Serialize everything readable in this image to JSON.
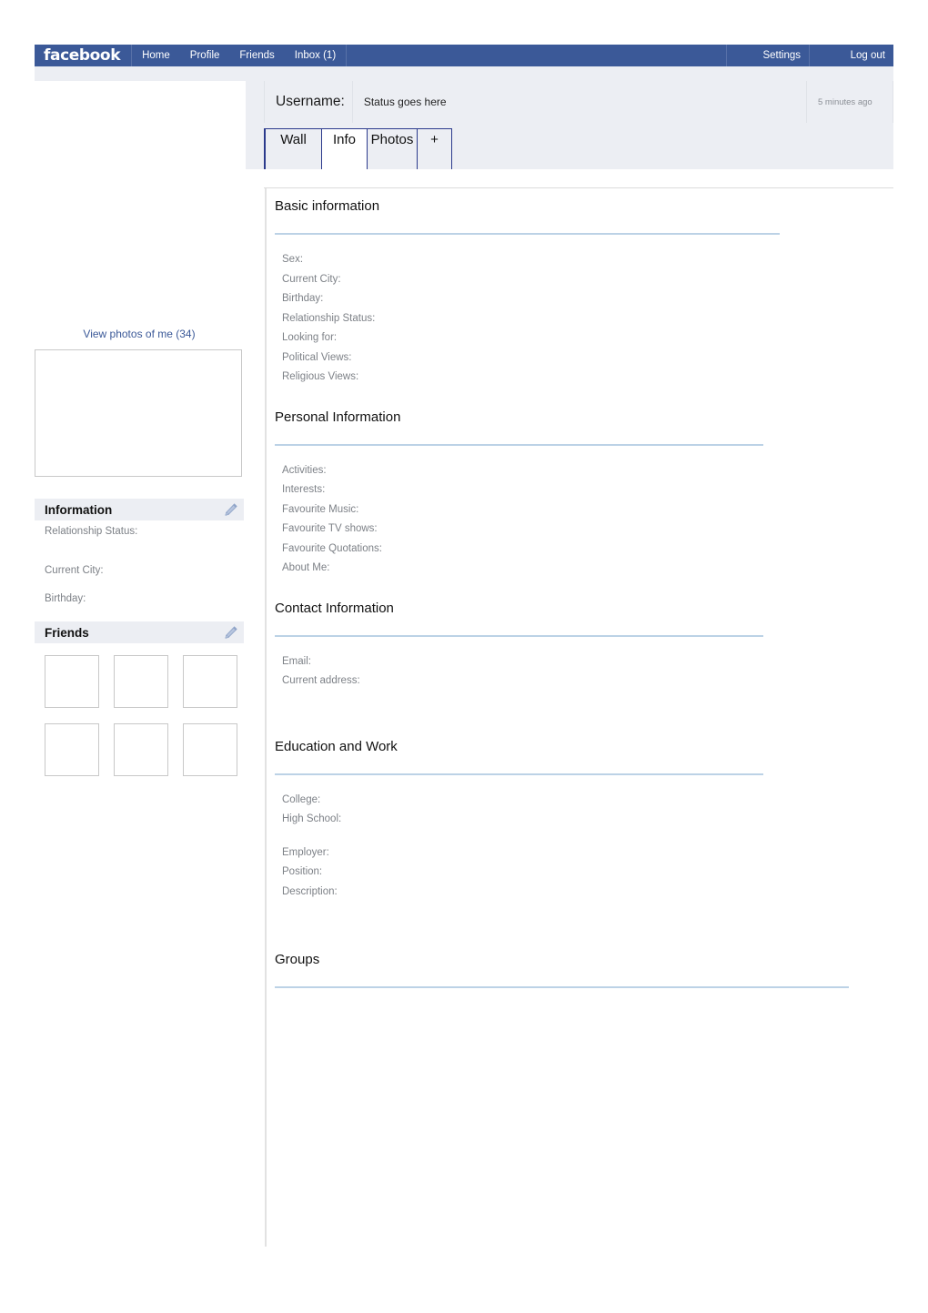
{
  "navbar": {
    "brand": "facebook",
    "links": [
      {
        "label": "Home"
      },
      {
        "label": "Profile"
      },
      {
        "label": "Friends"
      },
      {
        "label": "Inbox (1)"
      }
    ],
    "settings_label": "Settings",
    "logout_label": "Log out",
    "background_color": "#3b5998"
  },
  "profile_head": {
    "username_label": "Username:",
    "status_text": "Status goes here",
    "timestamp": "5 minutes ago",
    "tabs": [
      {
        "label": "Wall",
        "active": false
      },
      {
        "label": "Info",
        "active": true
      },
      {
        "label": "Photos",
        "active": false
      },
      {
        "label": "+",
        "active": false
      }
    ]
  },
  "sidebar": {
    "view_photos_link": "View photos of me (34)",
    "link_color": "#3b5998",
    "information_panel": {
      "title": "Information",
      "edit_icon": "pencil-icon",
      "fields": [
        "Relationship Status:",
        "Current City:",
        "Birthday:"
      ]
    },
    "friends_panel": {
      "title": "Friends",
      "edit_icon": "pencil-icon",
      "friend_count": 6
    }
  },
  "main": {
    "sections": [
      {
        "title": "Basic information",
        "fields": [
          "Sex:",
          "Current City:",
          "Birthday:",
          "Relationship Status:",
          "Looking for:",
          "Political Views:",
          "Religious Views:"
        ]
      },
      {
        "title": "Personal Information",
        "fields": [
          "Activities:",
          "Interests:",
          "Favourite Music:",
          "Favourite TV shows:",
          "Favourite Quotations:",
          "About Me:"
        ]
      },
      {
        "title": "Contact Information",
        "fields": [
          "Email:",
          "Current address:"
        ]
      },
      {
        "title": "Education and Work",
        "fields": [
          "College:",
          "High School:",
          "Employer:",
          "Position:",
          "Description:"
        ]
      },
      {
        "title": "Groups",
        "fields": []
      }
    ]
  }
}
